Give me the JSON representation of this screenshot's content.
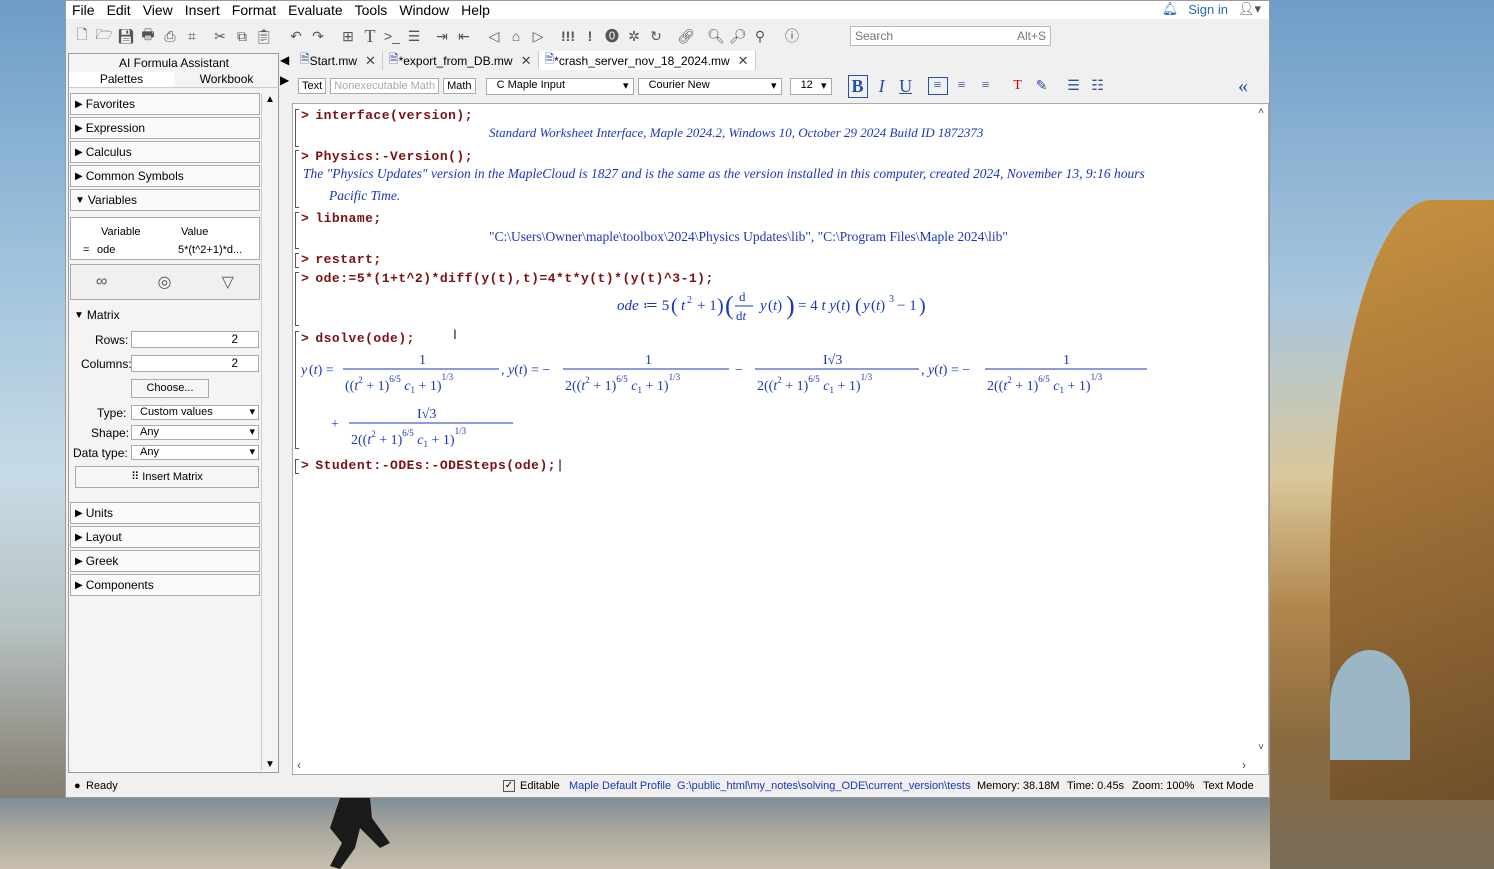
{
  "menu": [
    "File",
    "Edit",
    "View",
    "Insert",
    "Format",
    "Evaluate",
    "Tools",
    "Window",
    "Help"
  ],
  "signin": "Sign in",
  "search": {
    "placeholder": "Search",
    "shortcut": "Alt+S"
  },
  "left_panel": {
    "title": "AI Formula Assistant",
    "tabs": [
      "Palettes",
      "Workbook"
    ],
    "palettes_top": [
      "Favorites",
      "Expression",
      "Calculus",
      "Common Symbols",
      "Variables"
    ],
    "variables": {
      "col1": "Variable",
      "col2": "Value",
      "row_eq": "=",
      "row_name": "ode",
      "row_value": "5*(t^2+1)*d..."
    },
    "matrix": {
      "header": "Matrix",
      "rows_label": "Rows:",
      "rows_value": "2",
      "cols_label": "Columns:",
      "cols_value": "2",
      "choose": "Choose...",
      "type_label": "Type:",
      "type_value": "Custom values",
      "shape_label": "Shape:",
      "shape_value": "Any",
      "dtype_label": "Data type:",
      "dtype_value": "Any",
      "insert": "Insert Matrix"
    },
    "palettes_bottom": [
      "Units",
      "Layout",
      "Greek",
      "Components"
    ]
  },
  "doc_tabs": [
    {
      "label": "Start.mw"
    },
    {
      "label": "*export_from_DB.mw"
    },
    {
      "label": "*crash_server_nov_18_2024.mw"
    }
  ],
  "format_bar": {
    "text": "Text",
    "nonexec": "Nonexecutable Math",
    "math": "Math",
    "mode": "Maple Input",
    "font": "Courier New",
    "size": "12"
  },
  "worksheet": {
    "cmd1": "interface(version);",
    "out1": "Standard Worksheet Interface, Maple 2024.2, Windows 10, October 29 2024 Build ID 1872373",
    "cmd2": "Physics:-Version();",
    "out2a": "The \"Physics Updates\" version in the MapleCloud is 1827 and is the same as the version installed in this computer, created 2024, November 13, 9:16 hours",
    "out2b": "Pacific Time.",
    "cmd3": "libname;",
    "out3": "\"C:\\Users\\Owner\\maple\\toolbox\\2024\\Physics Updates\\lib\", \"C:\\Program Files\\Maple 2024\\lib\"",
    "cmd4": "restart;",
    "cmd5": "ode:=5*(1+t^2)*diff(y(t),t)=4*t*y(t)*(y(t)^3-1);",
    "cmd6": "dsolve(ode);",
    "cmd7": "Student:-ODEs:-ODESteps(ode);"
  },
  "status": {
    "ready": "Ready",
    "editable": "Editable",
    "profile": "Maple Default Profile",
    "path": "G:\\public_html\\my_notes\\solving_ODE\\current_version\\tests",
    "memory": "Memory: 38.18M",
    "time": "Time: 0.45s",
    "zoom": "Zoom: 100%",
    "mode": "Text Mode"
  }
}
